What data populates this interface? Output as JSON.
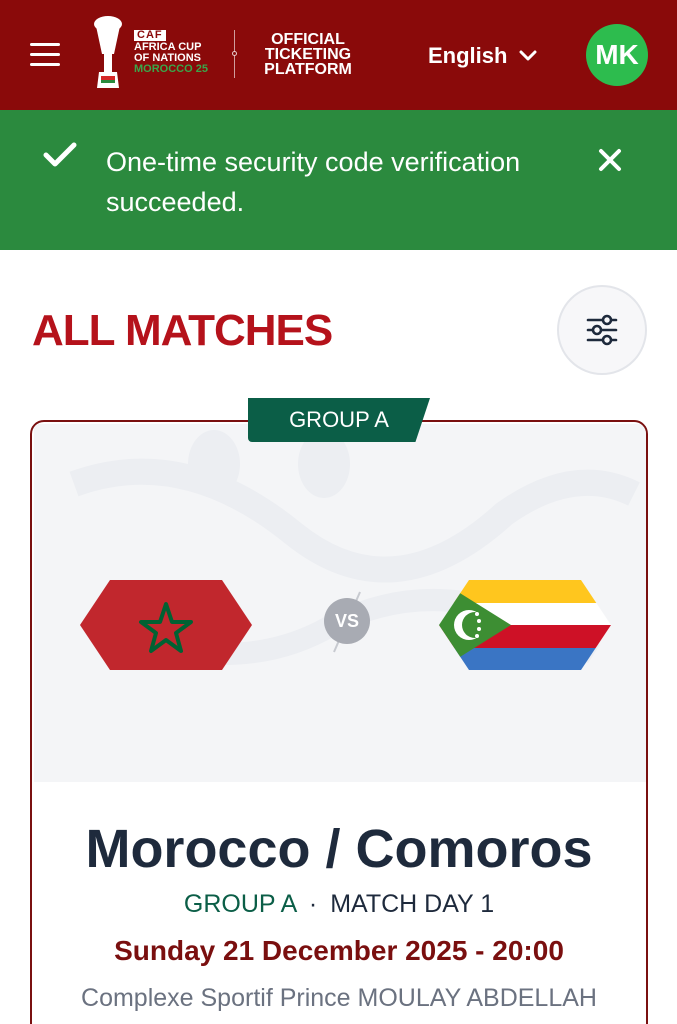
{
  "header": {
    "logo_caf": "CAF",
    "logo_line1": "AFRICA CUP",
    "logo_line2": "OF NATIONS",
    "logo_line3": "MOROCCO 25",
    "platform_line1": "OFFICIAL",
    "platform_line2": "TICKETING",
    "platform_line3": "PLATFORM",
    "language": "English",
    "avatar_initials": "MK"
  },
  "banner": {
    "message": "One-time security code verification succeeded."
  },
  "page": {
    "title": "ALL MATCHES"
  },
  "match": {
    "group_tag": "GROUP A",
    "vs_label": "VS",
    "teams": "Morocco / Comoros",
    "group": "GROUP A",
    "separator": "·",
    "match_day": "MATCH DAY 1",
    "date": "Sunday 21 December 2025 - 20:00",
    "venue": "Complexe Sportif Prince MOULAY ABDELLAH"
  },
  "icons": {
    "menu": "hamburger-menu-icon",
    "chevron": "chevron-down-icon",
    "check": "check-icon",
    "close": "close-icon",
    "filter": "sliders-filter-icon"
  },
  "colors": {
    "header_bg": "#8a0a0a",
    "banner_bg": "#2b8a3e",
    "title_red": "#b5121b",
    "group_green": "#0b5e47",
    "avatar_green": "#2dbc4e"
  }
}
